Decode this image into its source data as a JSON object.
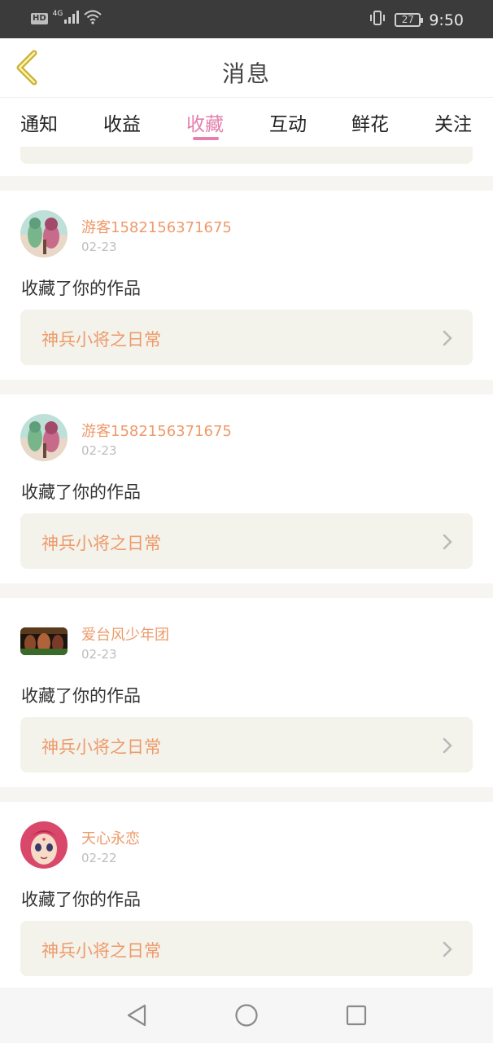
{
  "status_bar": {
    "hd": "HD",
    "network": "4G",
    "battery": "27",
    "time": "9:50"
  },
  "header": {
    "title": "消息"
  },
  "tabs": [
    {
      "label": "通知"
    },
    {
      "label": "收益"
    },
    {
      "label": "收藏",
      "active": true
    },
    {
      "label": "互动"
    },
    {
      "label": "鲜花"
    },
    {
      "label": "关注"
    }
  ],
  "cards": [
    {
      "user": "游客1582156371675",
      "date": "02-23",
      "action": "收藏了你的作品",
      "work": "神兵小将之日常",
      "avatar": "anime-characters-avatar"
    },
    {
      "user": "游客1582156371675",
      "date": "02-23",
      "action": "收藏了你的作品",
      "work": "神兵小将之日常",
      "avatar": "anime-characters-avatar"
    },
    {
      "user": "爱台风少年团",
      "date": "02-23",
      "action": "收藏了你的作品",
      "work": "神兵小将之日常",
      "avatar": "group-photo-avatar"
    },
    {
      "user": "天心永恋",
      "date": "02-22",
      "action": "收藏了你的作品",
      "work": "神兵小将之日常",
      "avatar": "anime-girl-avatar"
    }
  ],
  "colors": {
    "accent": "#e57fab",
    "username": "#ee9a6a",
    "back_arrow": "#c9b23a",
    "card_bg": "#f3f3ec"
  },
  "nav": {
    "back": "back-triangle-icon",
    "home": "home-circle-icon",
    "recents": "recents-square-icon"
  }
}
